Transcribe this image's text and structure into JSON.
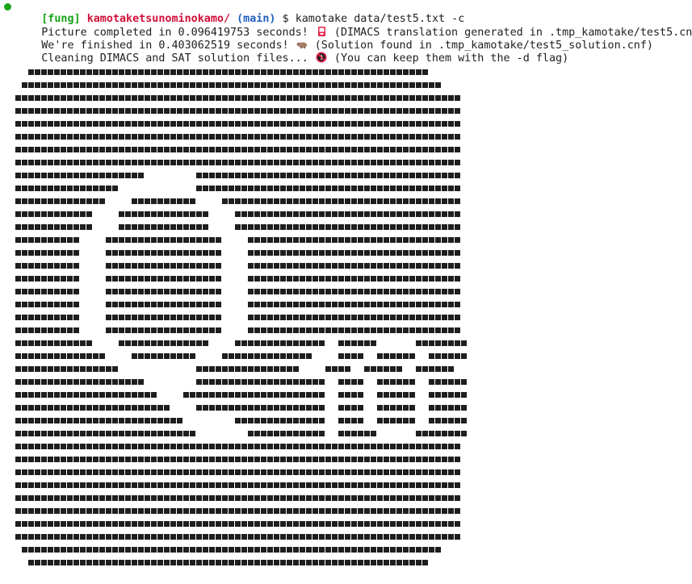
{
  "colors": {
    "prompt_dot": "#1aa31a",
    "user": "#1aa31a",
    "dir": "#d0103a",
    "branch": "#1f5fbf",
    "text": "#1e1e1e",
    "background": "#ffffff"
  },
  "prompt": {
    "user": "[fung]",
    "dir": "kamotaketsunominokamo/",
    "branch": "(main)",
    "symbol": "$",
    "command": "kamotake data/test5.txt -c"
  },
  "output": [
    {
      "before": "Picture completed in 0.096419753 seconds! ",
      "icon": "red-card-emoji",
      "after": " (DIMACS translation generated in .tmp_kamotake/test5.cnf)"
    },
    {
      "before": "We're finished in 0.403062519 seconds! ",
      "icon": "hippo-emoji",
      "after": " (Solution found in .tmp_kamotake/test5_solution.cnf)"
    },
    {
      "before": "Cleaning DIMACS and SAT solution files... ",
      "icon": "no-littering-emoji",
      "after": " (You can keep them with the -d flag)"
    }
  ],
  "art": [
    "  ■■■■■■■■■■■■■■■■■■■■■■■■■■■■■■■■■■■■■■■■■■■■■■■■■■■■■■■■■■■■■■  ",
    " ■■■■■■■■■■■■■■■■■■■■■■■■■■■■■■■■■■■■■■■■■■■■■■■■■■■■■■■■■■■■■■■■■ ",
    "■■■■■■■■■■■■■■■■■■■■■■■■■■■■■■■■■■■■■■■■■■■■■■■■■■■■■■■■■■■■■■■■■■■■■",
    "■■■■■■■■■■■■■■■■■■■■■■■■■■■■■■■■■■■■■■■■■■■■■■■■■■■■■■■■■■■■■■■■■■■■■",
    "■■■■■■■■■■■■■■■■■■■■■■■■■■■■■■■■■■■■■■■■■■■■■■■■■■■■■■■■■■■■■■■■■■■■■",
    "■■■■■■■■■■■■■■■■■■■■■■■■■■■■■■■■■■■■■■■■■■■■■■■■■■■■■■■■■■■■■■■■■■■■■",
    "■■■■■■■■■■■■■■■■■■■■■■■■■■■■■■■■■■■■■■■■■■■■■■■■■■■■■■■■■■■■■■■■■■■■■",
    "■■■■■■■■■■■■■■■■■■■■■■■■■■■■■■■■■■■■■■■■■■■■■■■■■■■■■■■■■■■■■■■■■■■■■",
    "■■■■■■■■■■■■■■■■■■■■        ■■■■■■■■■■■■■■■■■■■■■■■■■■■■■■■■■■■■■■■■■",
    "■■■■■■■■■■■■■■■■            ■■■■■■■■■■■■■■■■■■■■■■■■■■■■■■■■■■■■■■■■■",
    "■■■■■■■■■■■■■■    ■■■■■■■■■■    ■■■■■■■■■■■■■■■■■■■■■■■■■■■■■■■■■■■■■",
    "■■■■■■■■■■■■    ■■■■■■■■■■■■■■    ■■■■■■■■■■■■■■■■■■■■■■■■■■■■■■■■■■■",
    "■■■■■■■■■■■■    ■■■■■■■■■■■■■■    ■■■■■■■■■■■■■■■■■■■■■■■■■■■■■■■■■■■",
    "■■■■■■■■■■    ■■■■■■■■■■■■■■■■■■    ■■■■■■■■■■■■■■■■■■■■■■■■■■■■■■■■■",
    "■■■■■■■■■■    ■■■■■■■■■■■■■■■■■■    ■■■■■■■■■■■■■■■■■■■■■■■■■■■■■■■■■",
    "■■■■■■■■■■    ■■■■■■■■■■■■■■■■■■    ■■■■■■■■■■■■■■■■■■■■■■■■■■■■■■■■■",
    "■■■■■■■■■■    ■■■■■■■■■■■■■■■■■■    ■■■■■■■■■■■■■■■■■■■■■■■■■■■■■■■■■",
    "■■■■■■■■■■    ■■■■■■■■■■■■■■■■■■    ■■■■■■■■■■■■■■■■■■■■■■■■■■■■■■■■■",
    "■■■■■■■■■■    ■■■■■■■■■■■■■■■■■■    ■■■■■■■■■■■■■■■■■■■■■■■■■■■■■■■■■",
    "■■■■■■■■■■    ■■■■■■■■■■■■■■■■■■    ■■■■■■■■■■■■■■■■■■■■■■■■■■■■■■■■■",
    "■■■■■■■■■■    ■■■■■■■■■■■■■■■■■■    ■■■■■■■■■■■■■■■■■■■■■■■■■■■■■■■■■",
    "■■■■■■■■■■■■    ■■■■■■■■■■■■■■    ■■■■■■■■■■■■■■  ■■■■■■      ■■■■■■■■",
    "■■■■■■■■■■■■■■    ■■■■■■■■■■    ■■■■■■■■■■■■■■    ■■■■  ■■■■■■  ■■■■■■",
    "■■■■■■■■■■■■■■■■            ■■■■■■■■■■■■■■■■    ■■■■  ■■■■■■  ■■■■■■",
    "■■■■■■■■■■■■■■■■■■■■        ■■■■■■■■■■■■■■■■■■■■  ■■■■  ■■■■■■  ■■■■■■",
    "■■■■■■■■■■■■■■■■■■■■■■    ■■■■■■■■■■■■■■■■■■■■■■  ■■■■  ■■■■■■  ■■■■■■",
    "■■■■■■■■■■■■■■■■■■■■■■■■    ■■■■■■■■■■■■■■■■■■■■  ■■■■  ■■■■■■  ■■■■■■",
    "■■■■■■■■■■■■■■■■■■■■■■■■■■        ■■■■■■■■■■■■■■  ■■■■  ■■■■■■  ■■■■■■",
    "■■■■■■■■■■■■■■■■■■■■■■■■■■■■        ■■■■■■■■■■■■  ■■■■■■      ■■■■■■■■",
    "■■■■■■■■■■■■■■■■■■■■■■■■■■■■■■■■■■■■■■■■■■■■■■■■■■■■■■■■■■■■■■■■■■■■■",
    "■■■■■■■■■■■■■■■■■■■■■■■■■■■■■■■■■■■■■■■■■■■■■■■■■■■■■■■■■■■■■■■■■■■■■",
    "■■■■■■■■■■■■■■■■■■■■■■■■■■■■■■■■■■■■■■■■■■■■■■■■■■■■■■■■■■■■■■■■■■■■■",
    "■■■■■■■■■■■■■■■■■■■■■■■■■■■■■■■■■■■■■■■■■■■■■■■■■■■■■■■■■■■■■■■■■■■■■",
    "■■■■■■■■■■■■■■■■■■■■■■■■■■■■■■■■■■■■■■■■■■■■■■■■■■■■■■■■■■■■■■■■■■■■■",
    "■■■■■■■■■■■■■■■■■■■■■■■■■■■■■■■■■■■■■■■■■■■■■■■■■■■■■■■■■■■■■■■■■■■■■",
    "■■■■■■■■■■■■■■■■■■■■■■■■■■■■■■■■■■■■■■■■■■■■■■■■■■■■■■■■■■■■■■■■■■■■■",
    "■■■■■■■■■■■■■■■■■■■■■■■■■■■■■■■■■■■■■■■■■■■■■■■■■■■■■■■■■■■■■■■■■■■■■",
    " ■■■■■■■■■■■■■■■■■■■■■■■■■■■■■■■■■■■■■■■■■■■■■■■■■■■■■■■■■■■■■■■■■ ",
    "  ■■■■■■■■■■■■■■■■■■■■■■■■■■■■■■■■■■■■■■■■■■■■■■■■■■■■■■■■■■■■■■  "
  ]
}
